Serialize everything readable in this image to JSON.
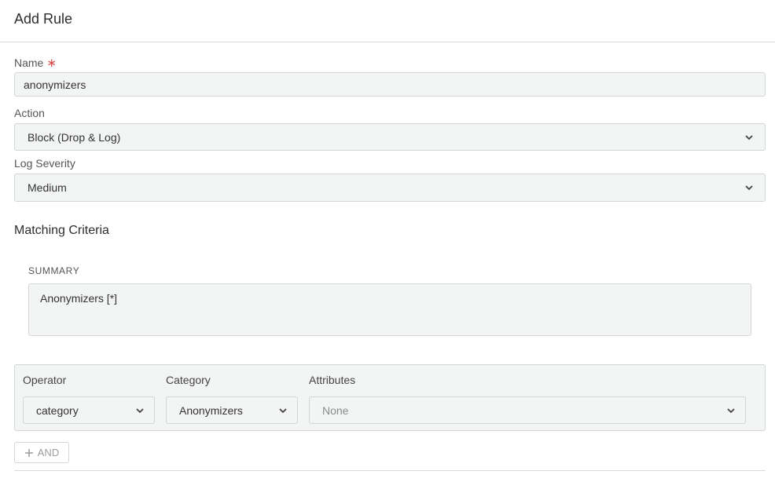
{
  "header": {
    "title": "Add Rule"
  },
  "form": {
    "name": {
      "label": "Name",
      "required_marker": "∗",
      "value": "anonymizers"
    },
    "action": {
      "label": "Action",
      "selected": "Block (Drop & Log)"
    },
    "log_severity": {
      "label": "Log Severity",
      "selected": "Medium"
    }
  },
  "matching_criteria": {
    "title": "Matching Criteria",
    "summary_label": "SUMMARY",
    "summary_text": "Anonymizers [*]",
    "columns": {
      "operator": {
        "label": "Operator",
        "selected": "category"
      },
      "category": {
        "label": "Category",
        "selected": "Anonymizers"
      },
      "attributes": {
        "label": "Attributes",
        "placeholder": "None"
      }
    },
    "and_button_label": "AND"
  },
  "icons": {
    "dropdown": "chevron-down-icon",
    "add": "plus-icon"
  },
  "colors": {
    "required": "#e04545",
    "field_bg": "#f3f4f4",
    "border": "#d3d6d6"
  }
}
